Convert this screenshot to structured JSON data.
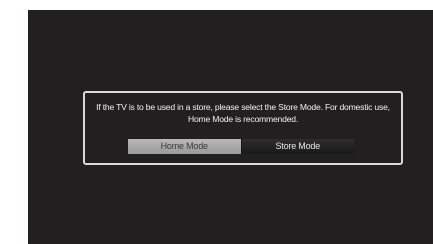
{
  "dialog": {
    "message_line1": "If the TV is to be used in a store, please select the Store Mode. For domestic use,",
    "message_line2": "Home Mode is recommended.",
    "buttons": {
      "home_label": "Home Mode",
      "store_label": "Store Mode"
    },
    "selected": "Home Mode"
  },
  "colors": {
    "screen_background": "#231f20",
    "dialog_border": "#d9d9d9",
    "selected_button": "#a8a8a8",
    "unselected_button": "#262626"
  }
}
